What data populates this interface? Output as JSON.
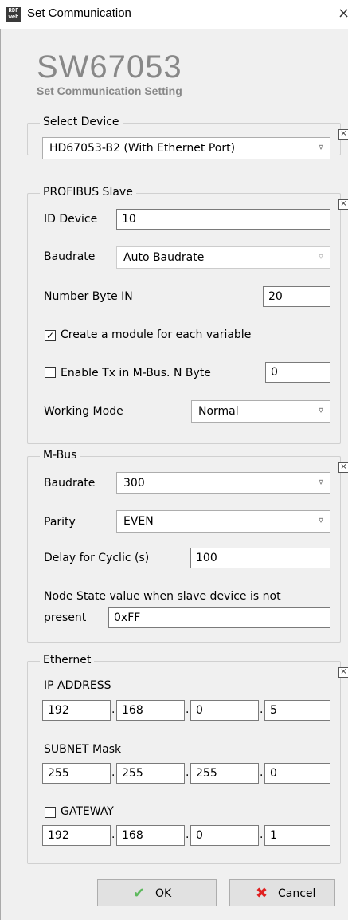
{
  "window": {
    "title": "Set Communication",
    "app_icon_text": "RDF\nweb",
    "close_glyph": "×"
  },
  "header": {
    "title": "SW67053",
    "subtitle": "Set Communication Setting"
  },
  "select_device": {
    "group_label": "Select Device",
    "selected": "HD67053-B2 (With Ethernet Port)"
  },
  "profibus": {
    "group_label": "PROFIBUS Slave",
    "id_device_label": "ID Device",
    "id_device_value": "10",
    "baudrate_label": "Baudrate",
    "baudrate_value": "Auto Baudrate",
    "number_byte_in_label": "Number Byte IN",
    "number_byte_in_value": "20",
    "create_module_label": "Create a module for each variable",
    "create_module_checked": true,
    "enable_tx_label": "Enable Tx in M-Bus. N Byte",
    "enable_tx_checked": false,
    "enable_tx_value": "0",
    "working_mode_label": "Working Mode",
    "working_mode_value": "Normal"
  },
  "mbus": {
    "group_label": "M-Bus",
    "baudrate_label": "Baudrate",
    "baudrate_value": "300",
    "parity_label": "Parity",
    "parity_value": "EVEN",
    "delay_label": "Delay for Cyclic (s)",
    "delay_value": "100",
    "node_state_label_line1": "Node State value when slave device is not",
    "node_state_label_line2": "present",
    "node_state_value": "0xFF"
  },
  "ethernet": {
    "group_label": "Ethernet",
    "ip_label": "IP ADDRESS",
    "ip": [
      "192",
      "168",
      "0",
      "5"
    ],
    "subnet_label": "SUBNET Mask",
    "subnet": [
      "255",
      "255",
      "255",
      "0"
    ],
    "gateway_label": "GATEWAY",
    "gateway_checked": false,
    "gateway": [
      "192",
      "168",
      "0",
      "1"
    ]
  },
  "buttons": {
    "ok_label": "OK",
    "cancel_label": "Cancel"
  },
  "icons": {
    "group_close": "close-box-icon",
    "dropdown": "chevron-down-icon",
    "ok": "checkmark-icon",
    "cancel": "red-x-icon"
  }
}
